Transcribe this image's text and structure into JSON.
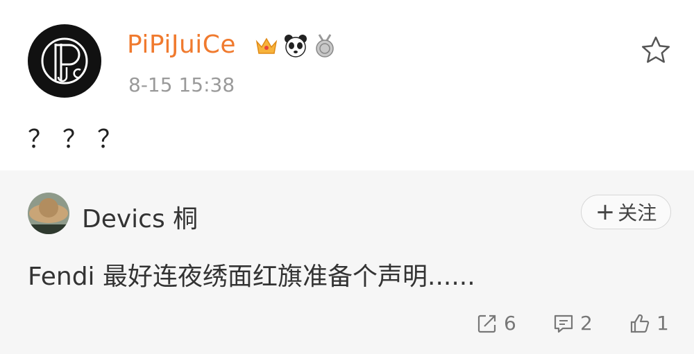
{
  "post": {
    "username": "PiPiJuiCe",
    "badges": [
      "crown-badge-icon",
      "panda-badge-icon",
      "medal-badge-icon"
    ],
    "time": "8-15 15:38",
    "text": "？？？"
  },
  "repost": {
    "username": "Devics 桐",
    "follow_label": "关注",
    "text": "Fendi 最好连夜绣面红旗准备个声明......",
    "actions": {
      "share_count": "6",
      "comment_count": "2",
      "like_count": "1"
    }
  },
  "colors": {
    "username": "#f07a2e",
    "repost_bg": "#f6f6f6"
  }
}
